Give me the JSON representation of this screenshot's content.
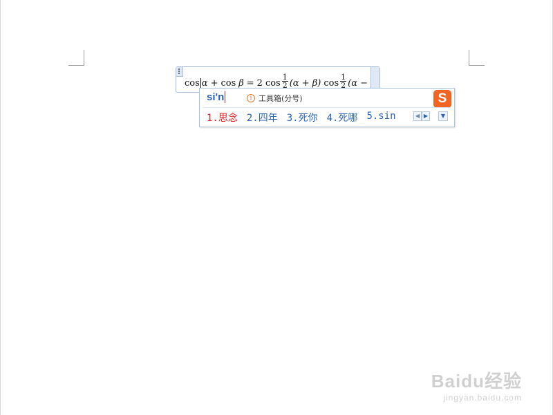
{
  "equation": {
    "tokens": {
      "cos1": "cos",
      "alpha1": "α",
      "plus1": "+",
      "cos2": "cos",
      "beta1": "β",
      "eq": "=",
      "two": "2",
      "cos3": "cos",
      "frac1_num": "1",
      "frac1_den": "2",
      "group1": "(α + β)",
      "cos4": "cos",
      "frac2_num": "1",
      "frac2_den": "2",
      "group2": "(α − β)"
    }
  },
  "ime": {
    "pinyin": "si'n",
    "toolbox_label": "工具箱(分号)",
    "logo_letter": "S",
    "candidates": [
      "1.思念",
      "2.四年",
      "3.死你",
      "4.死哪",
      "5.sin"
    ],
    "prev_page_icon": "triangle-left",
    "next_page_icon": "triangle-right",
    "expand_icon": "triangle-down",
    "colors": {
      "first_candidate": "#e02020",
      "candidate": "#2a62b8",
      "logo": "#f26522"
    }
  },
  "watermark": {
    "main": "Baidu经验",
    "sub": "jingyan.baidu.com"
  }
}
